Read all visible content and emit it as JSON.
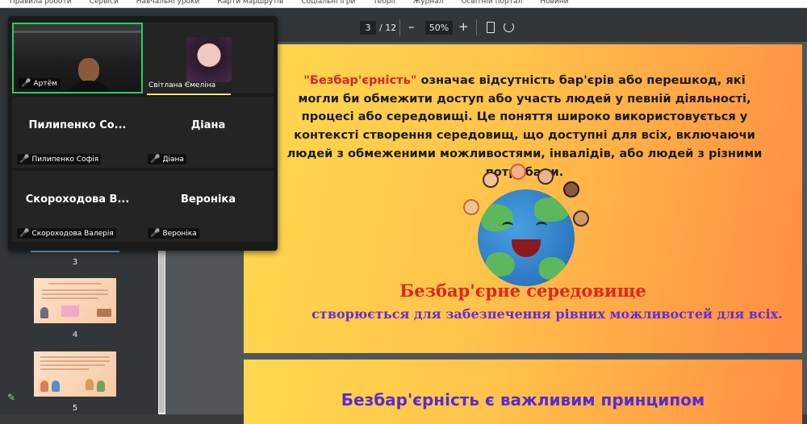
{
  "bookmarks": [
    "Правила роботи",
    "Сервіси",
    "Навчальні уроки",
    "Карти маршрутів",
    "Соціальні ігри",
    "Теорії",
    "Журнал",
    "Освітній портал",
    "Новини"
  ],
  "pdf_toolbar": {
    "current_page": "3",
    "total_pages": "/ 12",
    "zoom_out": "–",
    "zoom_level": "50%",
    "zoom_in": "+"
  },
  "thumbnails": [
    {
      "number": "3",
      "selected": true
    },
    {
      "number": "4",
      "selected": false
    },
    {
      "number": "5",
      "selected": false
    }
  ],
  "zoom_panel": {
    "participants": [
      {
        "tile_name": "",
        "tag": "Артём",
        "video": true
      },
      {
        "tile_name": "",
        "tag": "Світлана Ємеліна",
        "video": false
      },
      {
        "tile_name": "Пилипенко Со...",
        "tag": "Пилипенко Софія"
      },
      {
        "tile_name": "Діана",
        "tag": "Діана"
      },
      {
        "tile_name": "Скороходова В...",
        "tag": "Скороходова Валерія"
      },
      {
        "tile_name": "Вероніка",
        "tag": "Вероніка"
      }
    ]
  },
  "slide": {
    "highlight": "\"Безбар'єрність\"",
    "paragraph": " означає відсутність бар'єрів або перешкод, які могли би обмежити доступ або участь людей у певній діяльності, процесі або середовищі. Це поняття широко використовується у контексті створення середовищ, що доступні для всіх, включаючи людей з обмеженими можливостями, інвалідів, або людей з різними потребами.",
    "heading": "Безбар'єрне середовище",
    "subheading": "створюється для забезпечення рівних можливостей для всіх."
  },
  "slide2": {
    "title": "Безбар'єрність є важливим принципом"
  },
  "colors": {
    "toolbar_bg": "#323639",
    "active_speaker": "#23d160",
    "slide_red": "#e0251f",
    "slide_purple": "#6a2bd0"
  }
}
